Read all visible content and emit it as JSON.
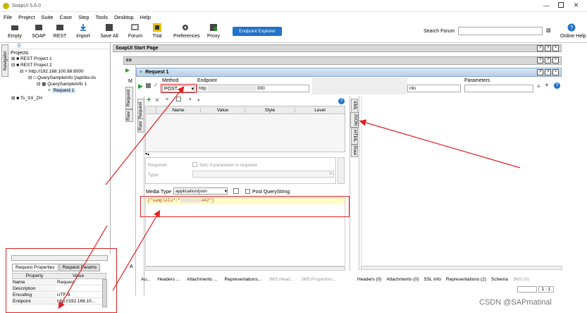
{
  "window": {
    "title": "SoapUI 5.6.0"
  },
  "menu": [
    "File",
    "Project",
    "Suite",
    "Case",
    "Step",
    "Tools",
    "Desktop",
    "Help"
  ],
  "toolbar": {
    "empty": "Empty",
    "soap": "SOAP",
    "rest": "REST",
    "import": "Import",
    "save_all": "Save All",
    "forum": "Forum",
    "trial": "Trial",
    "preferences": "Preferences",
    "proxy": "Proxy",
    "endpoint_explorer": "Endpoint Explorer",
    "search_forum": "Search Forum",
    "online_help": "Online Help"
  },
  "navigator": {
    "tab": "Navigator",
    "root": "Projects",
    "items": [
      "REST Project 1",
      "REST Project 2",
      "http://192.168.100.88:8000",
      "QuerySampleInfo [/api/bis-lis",
      "QuerySampleInfo 1",
      "Request 1",
      "Ts_SX_ZH"
    ]
  },
  "start_page": {
    "title": "SoapUI Start Page"
  },
  "cs_panel": {
    "title": "cs"
  },
  "request": {
    "title": "Request 1",
    "method_label": "Method",
    "method_value": "POST",
    "endpoint_label": "Endpoint",
    "endpoint_value": "http",
    "endpoint_suffix": "000",
    "resource_suffix": "nfo",
    "parameters_label": "Parameters"
  },
  "params_table": {
    "headers": [
      "Name",
      "Value",
      "Style",
      "Level"
    ]
  },
  "param_detail": {
    "required": "Required:",
    "required_check": "Sets if parameter is required",
    "type": "Type:"
  },
  "media": {
    "label": "Media Type",
    "value": "application/json",
    "post_query": "Post QueryString",
    "body": "{\"sampleIu\":\"",
    "body_end": "442\"}"
  },
  "left_tabs": [
    "Request",
    "Raw",
    "Request",
    "Raw"
  ],
  "resp_tabs": [
    "XML",
    "JSON",
    "HTML",
    "Raw"
  ],
  "req_bottom_tabs": [
    "Au...",
    "Headers ...",
    "Attachments ...",
    "Representations...",
    "JMS Head...",
    "JMS Properties..."
  ],
  "resp_bottom_tabs": [
    "Headers (0)",
    "Attachments (0)",
    "SSL Info",
    "Representations (2)",
    "Schema",
    "JMS (0)"
  ],
  "status": {
    "position": "1 : 1"
  },
  "props": {
    "tab1": "Request Properties",
    "tab2": "Request Params",
    "col_property": "Property",
    "col_value": "Value",
    "rows": [
      [
        "Name",
        "Request"
      ],
      [
        "Description",
        ""
      ],
      [
        "Encoding",
        "UTF-8"
      ],
      [
        "Endpoint",
        "http://192.168.10..."
      ]
    ]
  },
  "watermark": "CSDN @SAPmatinal",
  "side_letter": "M",
  "side_letter2": "A",
  "colors": {
    "accent": "#2e7bd6",
    "annotation_red": "#e02020"
  }
}
